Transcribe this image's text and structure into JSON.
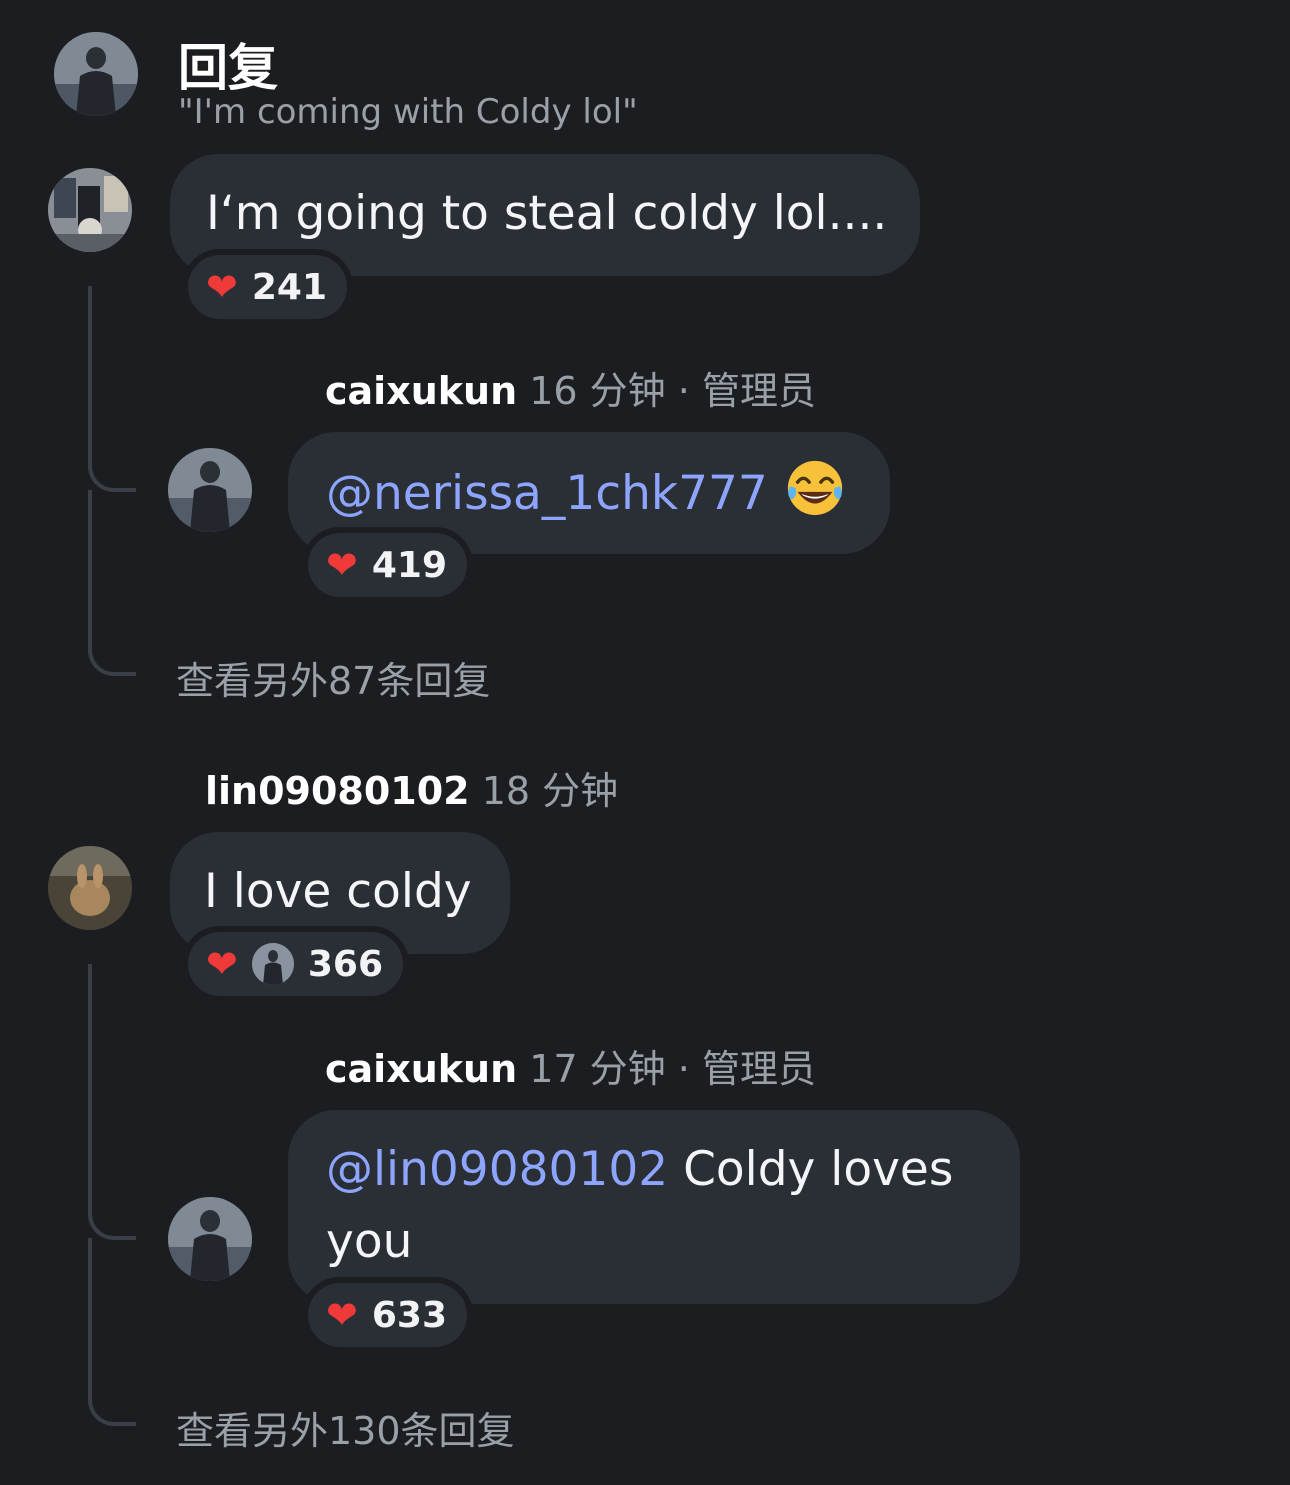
{
  "header": {
    "title": "回复",
    "subtitle": "\"I'm coming with Coldy lol\""
  },
  "comments": [
    {
      "text": "I‘m going to steal coldy lol....",
      "reaction": {
        "icon": "heart-icon",
        "count": "241"
      },
      "replies": [
        {
          "user": "caixukun",
          "time": "16 分钟",
          "dot": "·",
          "role": "管理员",
          "mention": "@nerissa_1chk777",
          "text": "",
          "emoji": "face-with-tears-of-joy-icon",
          "reaction": {
            "icon": "heart-icon",
            "count": "419"
          }
        }
      ],
      "more_replies": "查看另外87条回复"
    },
    {
      "user": "lin09080102",
      "time": "18 分钟",
      "text": "I love coldy",
      "reaction": {
        "icon": "heart-icon",
        "count": "366"
      },
      "replies": [
        {
          "user": "caixukun",
          "time": "17 分钟",
          "dot": "·",
          "role": "管理员",
          "mention": "@lin09080102",
          "text_line1": " Coldy loves",
          "text_line2": "you",
          "reaction": {
            "icon": "heart-icon",
            "count": "633"
          }
        }
      ],
      "more_replies": "查看另外130条回复"
    }
  ],
  "colors": {
    "background": "#1b1d21",
    "bubble": "#2a2e35",
    "mention": "#8ea5ff",
    "heart": "#f03a3a",
    "muted_text": "#9aa0a8"
  }
}
